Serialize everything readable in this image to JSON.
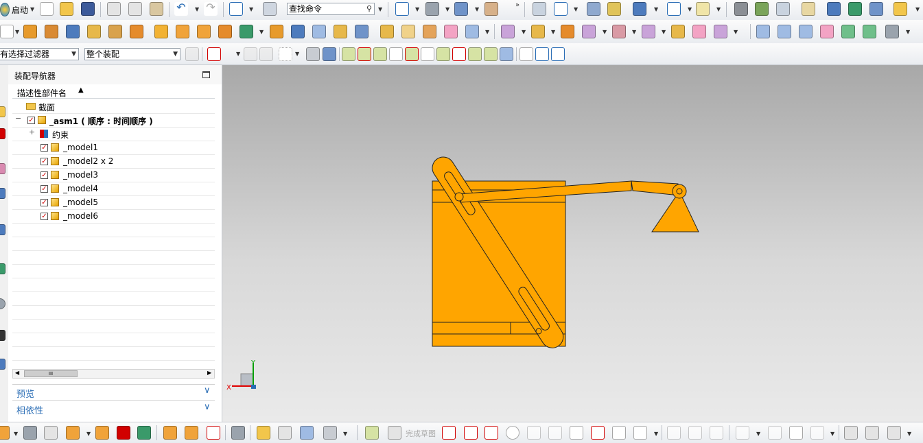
{
  "toolbar": {
    "start_label": "启动",
    "search_placeholder": "查找命令",
    "finish_sketch_label": "完成草图"
  },
  "filter": {
    "type_filter": "有选择过滤器",
    "scope": "整个装配"
  },
  "navigator": {
    "title": "装配导航器",
    "column_header": "描述性部件名",
    "items": [
      {
        "label": "截面"
      },
      {
        "label": "_asm1 ( 顺序 : 时间顺序 )"
      },
      {
        "label": "约束"
      },
      {
        "label": "_model1"
      },
      {
        "label": "_model2 x 2"
      },
      {
        "label": "_model3"
      },
      {
        "label": "_model4"
      },
      {
        "label": "_model5"
      },
      {
        "label": "_model6"
      }
    ],
    "scroll_thumb": "III",
    "sections": [
      {
        "label": "预览"
      },
      {
        "label": "相依性"
      }
    ]
  },
  "viewport": {
    "model_color": "#FFA500",
    "axis_x_label": "X",
    "axis_y_label": "Y"
  },
  "colors": {
    "accent_blue": "#2a6db5",
    "check_red": "#d10000",
    "axis_red": "#e00000",
    "axis_green": "#00a000"
  }
}
